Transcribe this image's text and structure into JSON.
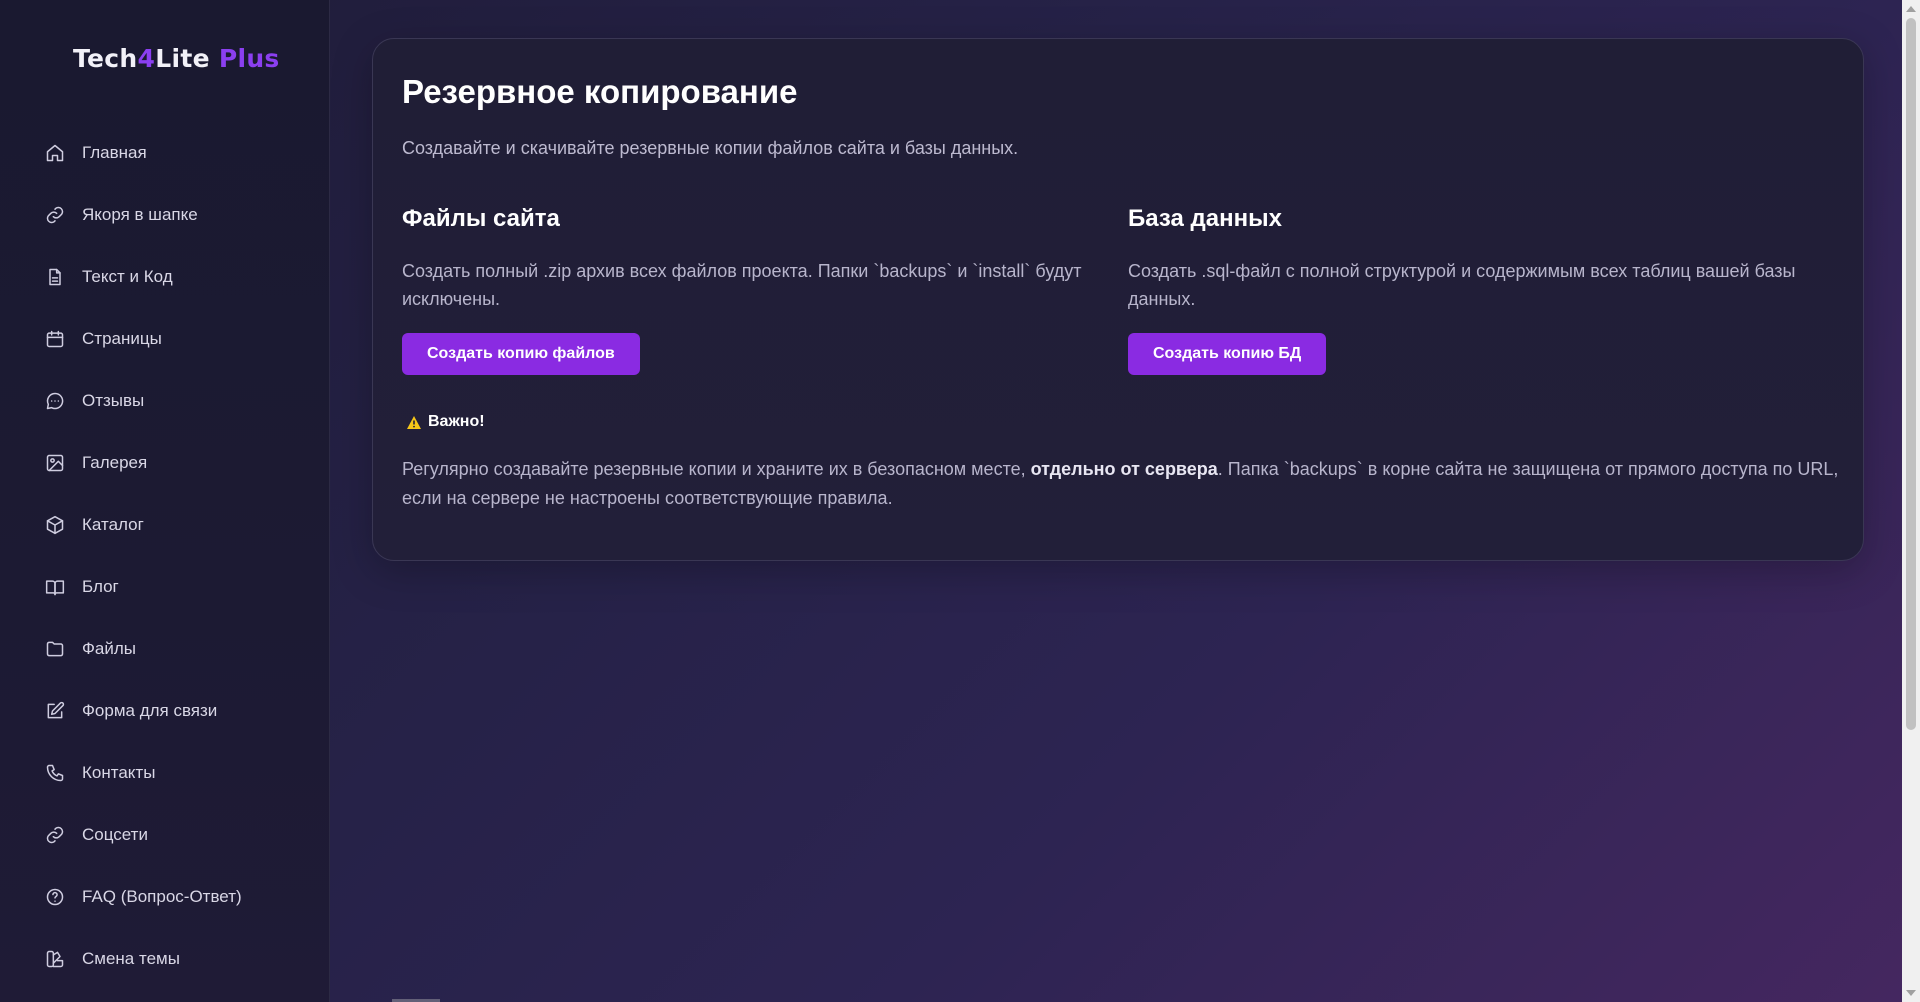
{
  "logo": {
    "part1": "Tech",
    "part2": "4",
    "part3": "Lite",
    "part4": "Plus"
  },
  "sidebar": {
    "items": [
      {
        "label": "Главная",
        "icon": "home-icon"
      },
      {
        "label": "Якоря в шапке",
        "icon": "link-icon"
      },
      {
        "label": "Текст и Код",
        "icon": "document-icon"
      },
      {
        "label": "Страницы",
        "icon": "calendar-icon"
      },
      {
        "label": "Отзывы",
        "icon": "chat-icon"
      },
      {
        "label": "Галерея",
        "icon": "image-icon"
      },
      {
        "label": "Каталог",
        "icon": "box-icon"
      },
      {
        "label": "Блог",
        "icon": "book-icon"
      },
      {
        "label": "Файлы",
        "icon": "folder-icon"
      },
      {
        "label": "Форма для связи",
        "icon": "edit-icon"
      },
      {
        "label": "Контакты",
        "icon": "phone-icon"
      },
      {
        "label": "Соцсети",
        "icon": "link-icon"
      },
      {
        "label": "FAQ (Вопрос-Ответ)",
        "icon": "question-icon"
      },
      {
        "label": "Смена темы",
        "icon": "palette-icon"
      }
    ]
  },
  "main": {
    "title": "Резервное копирование",
    "subtitle": "Создавайте и скачивайте резервные копии файлов сайта и базы данных.",
    "files": {
      "heading": "Файлы сайта",
      "description": "Создать полный .zip архив всех файлов проекта. Папки `backups` и `install` будут исключены.",
      "button": "Создать копию файлов"
    },
    "database": {
      "heading": "База данных",
      "description": "Создать .sql-файл с полной структурой и содержимым всех таблиц вашей базы данных.",
      "button": "Создать копию БД"
    },
    "important": {
      "label": "Важно!",
      "text_before": "Регулярно создавайте резервные копии и храните их в безопасном месте, ",
      "text_bold": "отдельно от сервера",
      "text_after": ". Папка `backups` в корне сайта не защищена от прямого доступа по URL, если на сервере не настроены соответствующие правила."
    }
  },
  "colors": {
    "accent": "#8a2be2",
    "background": "#262248",
    "sidebar": "#1c1a33",
    "warning": "#f5c518"
  }
}
